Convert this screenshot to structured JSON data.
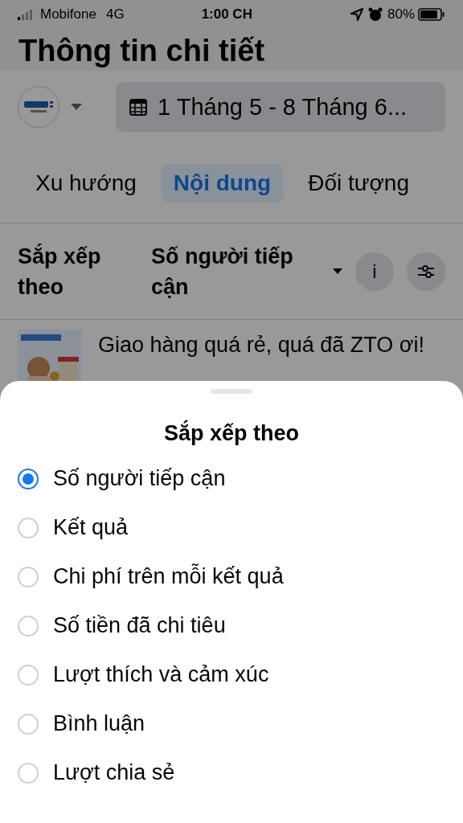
{
  "status_bar": {
    "carrier": "Mobifone",
    "network": "4G",
    "time": "1:00 CH",
    "battery": "80%"
  },
  "header": {
    "title": "Thông tin chi tiết"
  },
  "filters": {
    "date_range": "1 Tháng 5 - 8 Tháng 6..."
  },
  "tabs": [
    {
      "label": "Xu hướng",
      "selected": false
    },
    {
      "label": "Nội dung",
      "selected": true
    },
    {
      "label": "Đối tượng",
      "selected": false
    }
  ],
  "sort_bar": {
    "label": "Sắp xếp theo",
    "value": "Số người tiếp cận",
    "info": "i"
  },
  "post": {
    "text": "Giao hàng quá rẻ, quá đã ZTO ơi!"
  },
  "sheet": {
    "title": "Sắp xếp theo",
    "options": [
      {
        "label": "Số người tiếp cận",
        "selected": true
      },
      {
        "label": "Kết quả",
        "selected": false
      },
      {
        "label": "Chi phí trên mỗi kết quả",
        "selected": false
      },
      {
        "label": "Số tiền đã chi tiêu",
        "selected": false
      },
      {
        "label": "Lượt thích và cảm xúc",
        "selected": false
      },
      {
        "label": "Bình luận",
        "selected": false
      },
      {
        "label": "Lượt chia sẻ",
        "selected": false
      }
    ]
  }
}
